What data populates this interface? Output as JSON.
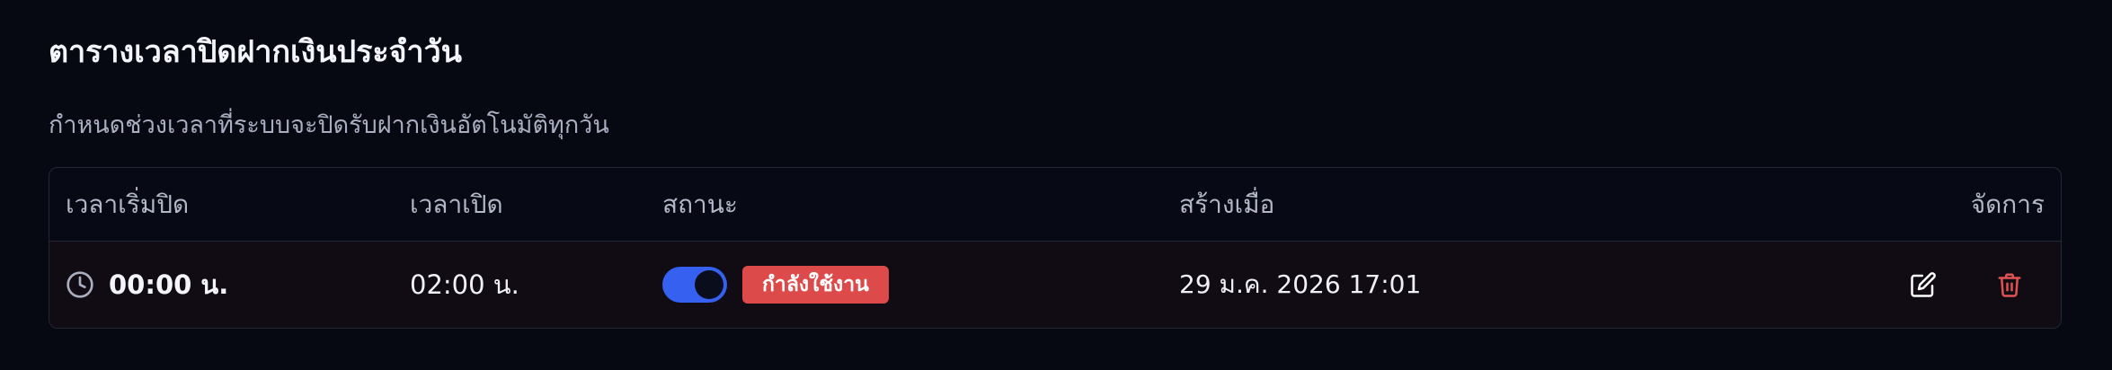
{
  "header": {
    "title": "ตารางเวลาปิดฝากเงินประจำวัน",
    "subtitle": "กำหนดช่วงเวลาที่ระบบจะปิดรับฝากเงินอัตโนมัติทุกวัน"
  },
  "table": {
    "columns": [
      "เวลาเริ่มปิด",
      "เวลาเปิด",
      "สถานะ",
      "สร้างเมื่อ",
      "จัดการ"
    ],
    "rows": [
      {
        "start_time": "00:00 น.",
        "open_time": "02:00 น.",
        "enabled": true,
        "status_label": "กำลังใช้งาน",
        "created_at": "29 ม.ค. 2026 17:01",
        "icons": [
          "clock-icon",
          "edit-icon",
          "trash-icon"
        ]
      }
    ]
  },
  "colors": {
    "background": "#060812",
    "toggle_on": "#3560f0",
    "status_active": "#dc4a4a",
    "delete_icon": "#e05252"
  }
}
